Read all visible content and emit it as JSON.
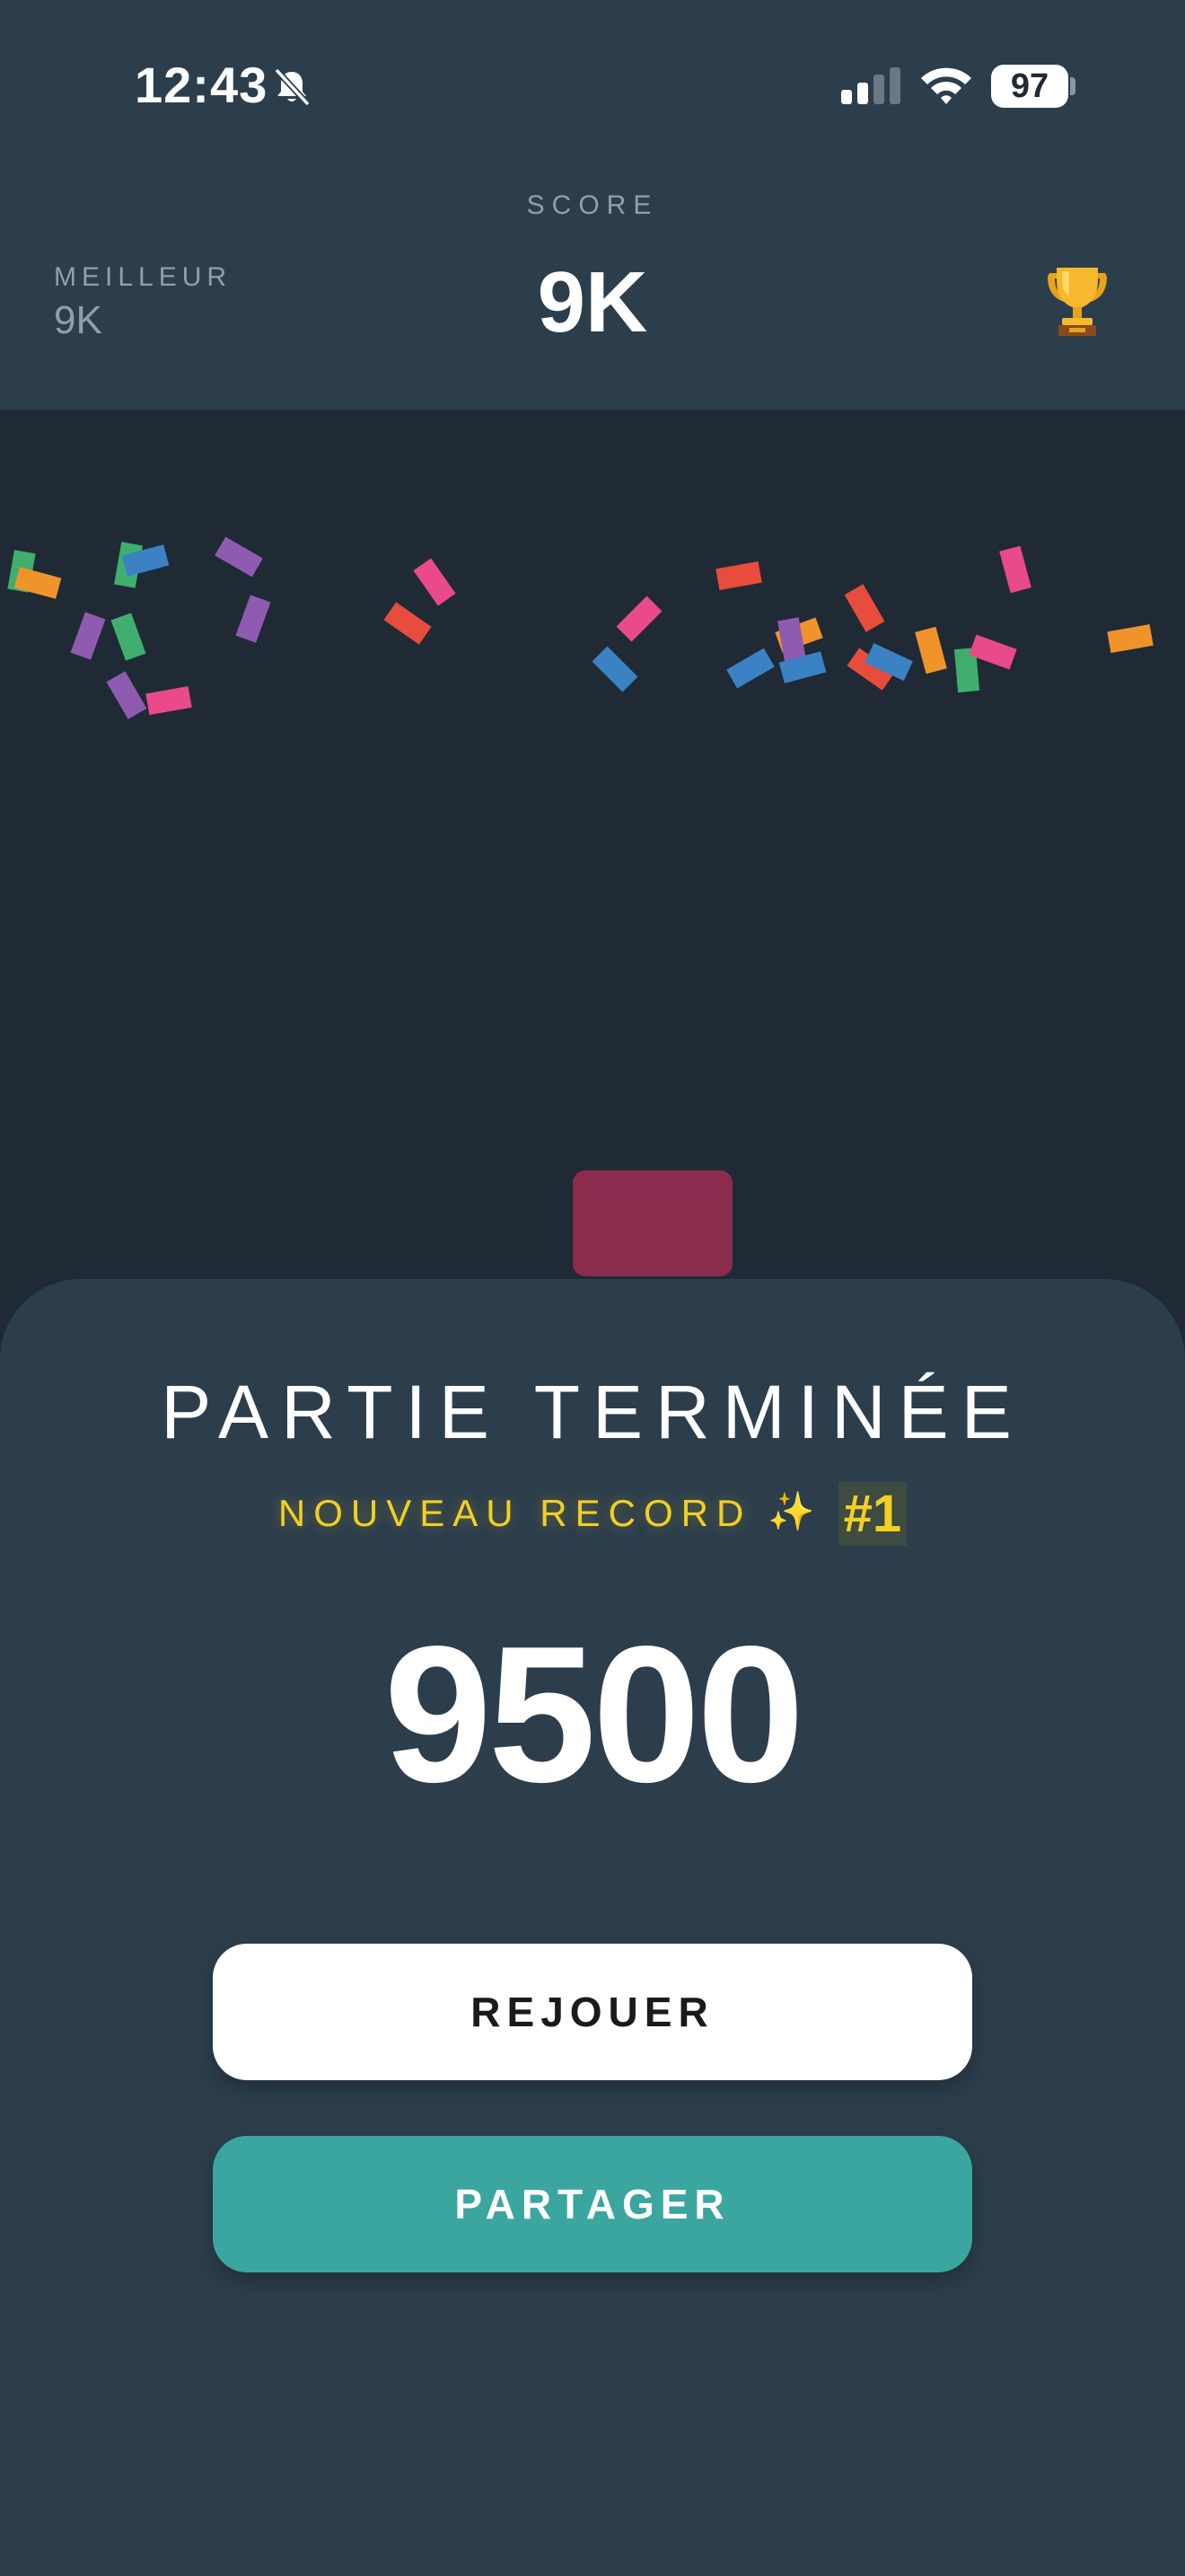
{
  "status_bar": {
    "time": "12:43",
    "battery_level": "97",
    "icons": [
      "bell-slash-icon",
      "cellular-signal-icon",
      "wifi-icon",
      "battery-icon"
    ]
  },
  "header": {
    "score_label": "SCORE",
    "score_value": "9K",
    "best_label": "MEILLEUR",
    "best_value": "9K",
    "trophy_icon": "trophy-icon"
  },
  "confetti_colors": [
    "#e74c3c",
    "#3b82c4",
    "#8e5bb0",
    "#e84a8a",
    "#f0932b",
    "#3fae6e"
  ],
  "player_block_color": "#8a2c4e",
  "game_over": {
    "title": "PARTIE TERMINÉE",
    "record_text": "NOUVEAU RECORD",
    "sparkle": "✨",
    "rank": "#1",
    "final_score": "9500",
    "replay_label": "REJOUER",
    "share_label": "PARTAGER"
  },
  "colors": {
    "background": "#1f2a35",
    "header": "#2c3e4c",
    "accent_yellow": "#f3cf24",
    "share_button": "#3ba6a0"
  }
}
